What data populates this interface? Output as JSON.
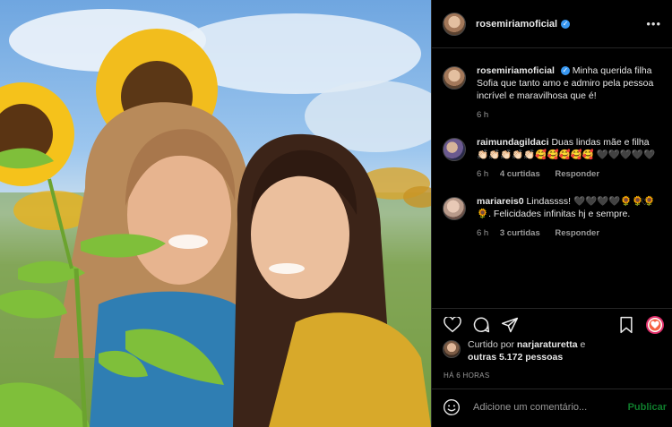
{
  "post": {
    "username": "rosemiriamoficial",
    "verified_mark": "✓",
    "more_icon": "more-icon"
  },
  "caption": {
    "username": "rosemiriamoficial",
    "text": "Minha querida filha Sofia que tanto amo e admiro pela pessoa incrível e maravilhosa que é!",
    "time": "6 h"
  },
  "comments": [
    {
      "username": "raimundagildaci",
      "text": "Duas lindas mãe e filha 👏🏻👏🏻👏🏻👏🏻👏🏻🥰🥰🥰🥰🥰 🖤🖤🖤🖤🖤",
      "time": "6 h",
      "likes": "4 curtidas",
      "reply": "Responder"
    },
    {
      "username": "mariareis0",
      "text": "Lindassss! 🖤🖤🖤🖤🌻🌻🌻🌻. Felicidades infinitas hj e sempre.",
      "time": "6 h",
      "likes": "3 curtidas",
      "reply": "Responder"
    }
  ],
  "likes": {
    "prefix": "Curtido por",
    "user": "narjaraturetta",
    "conj": "e",
    "others": "outras 5.172 pessoas"
  },
  "ago": "HÁ 6 HORAS",
  "add_comment": {
    "placeholder": "Adicione um comentário...",
    "publish": "Publicar"
  }
}
